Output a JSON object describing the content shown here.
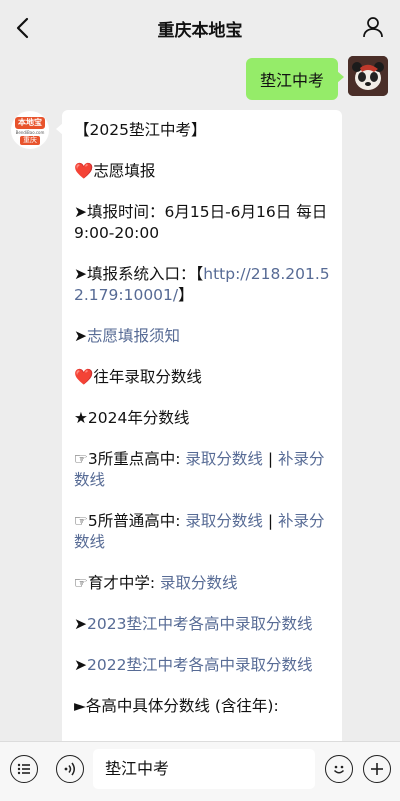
{
  "header": {
    "title": "重庆本地宝",
    "back_icon": "chevron-left-icon",
    "profile_icon": "person-icon"
  },
  "user_message": {
    "text": "垫江中考"
  },
  "bot_avatar": {
    "logo_text": "本地宝",
    "logo_url_text": "BendiBao.com",
    "city_text": "重庆"
  },
  "bot_message": {
    "title": "【2025垫江中考】",
    "section1_heading": "志愿填报",
    "fill_time_label": "➤填报时间：",
    "fill_time_value": "6月15日-6月16日 每日9:00-20:00",
    "entry_label": "➤填报系统入口：【",
    "entry_link": "http://218.201.52.179:10001/",
    "entry_suffix": "】",
    "notice_prefix": "➤",
    "notice_link": "志愿填报须知",
    "section2_heading": "往年录取分数线",
    "year_heading": "★2024年分数线",
    "key_schools_label": "☞3所重点高中: ",
    "key_schools_link1": "录取分数线",
    "separator": " | ",
    "key_schools_link2": "补录分数线",
    "normal_schools_label": "☞5所普通高中: ",
    "normal_schools_link1": "录取分数线",
    "normal_schools_link2": "补录分数线",
    "yucai_label": "☞育才中学: ",
    "yucai_link": "录取分数线",
    "link_2023_prefix": "➤",
    "link_2023": "2023垫江中考各高中录取分数线",
    "link_2022_prefix": "➤",
    "link_2022": "2022垫江中考各高中录取分数线",
    "detail_heading": "►各高中具体分数线 (含往年):"
  },
  "footer": {
    "input_value": "垫江中考",
    "menu_icon": "menu-list-icon",
    "voice_icon": "voice-icon",
    "emoji_icon": "emoji-icon",
    "add_icon": "plus-icon"
  }
}
